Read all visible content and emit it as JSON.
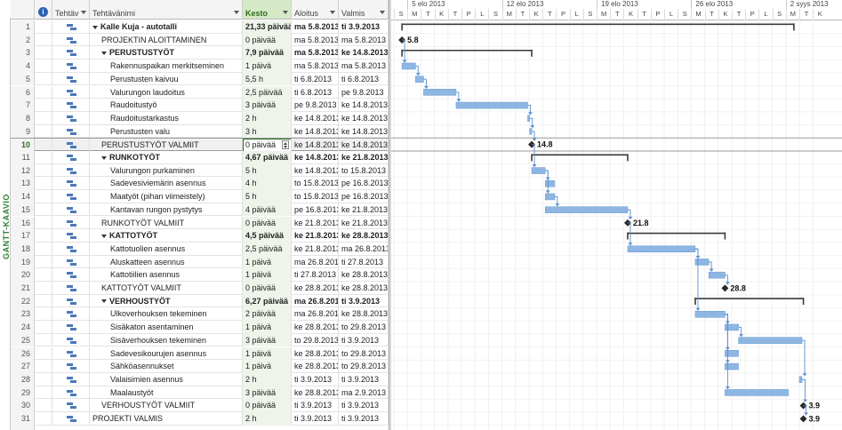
{
  "side_label": "GANTT-KAAVIO",
  "columns": {
    "info": "i",
    "mode": "Tehtäv",
    "name": "Tehtävänimi",
    "duration": "Kesto",
    "start": "Aloitus",
    "finish": "Valmis"
  },
  "timescale": {
    "weeks": [
      "5 elo 2013",
      "12 elo 2013",
      "19 elo 2013",
      "26 elo 2013",
      "2 syys 2013"
    ],
    "days": [
      "S",
      "M",
      "T",
      "K",
      "T",
      "P",
      "L",
      "S",
      "M",
      "T",
      "K",
      "T",
      "P",
      "L",
      "S",
      "M",
      "T",
      "K",
      "T",
      "P",
      "L",
      "S",
      "M",
      "T",
      "K",
      "T",
      "P",
      "L",
      "S",
      "M",
      "T",
      "K"
    ]
  },
  "selected_row": 10,
  "tasks": [
    {
      "id": "1",
      "name": "Kalle Kuja - autotalli",
      "duration": "21,33 päivää",
      "start": "ma 5.8.2013",
      "finish": "ti 3.9.2013",
      "level": 0,
      "summary": true,
      "bold": true
    },
    {
      "id": "2",
      "name": "PROJEKTIN ALOITTAMINEN",
      "duration": "0 päivää",
      "start": "ma 5.8.2013",
      "finish": "ma 5.8.2013",
      "level": 1,
      "milestone": true,
      "mlabel": "5.8"
    },
    {
      "id": "3",
      "name": "PERUSTUSTYÖT",
      "duration": "7,9 päivää",
      "start": "ma 5.8.2013",
      "finish": "ke 14.8.2013",
      "level": 1,
      "summary": true,
      "bold": true
    },
    {
      "id": "4",
      "name": "Rakennuspaikan merkitseminen",
      "duration": "1 päivä",
      "start": "ma 5.8.2013",
      "finish": "ma 5.8.2013",
      "level": 2
    },
    {
      "id": "5",
      "name": "Perustusten kaivuu",
      "duration": "5,5 h",
      "start": "ti 6.8.2013",
      "finish": "ti 6.8.2013",
      "level": 2
    },
    {
      "id": "6",
      "name": "Valurungon laudoitus",
      "duration": "2,5 päivää",
      "start": "ti 6.8.2013",
      "finish": "pe 9.8.2013",
      "level": 2
    },
    {
      "id": "7",
      "name": "Raudoitustyö",
      "duration": "3 päivää",
      "start": "pe 9.8.2013",
      "finish": "ke 14.8.2013",
      "level": 2
    },
    {
      "id": "8",
      "name": "Raudoitustarkastus",
      "duration": "2 h",
      "start": "ke 14.8.2013",
      "finish": "ke 14.8.2013",
      "level": 2
    },
    {
      "id": "9",
      "name": "Perustusten valu",
      "duration": "3 h",
      "start": "ke 14.8.2013",
      "finish": "ke 14.8.2013",
      "level": 2
    },
    {
      "id": "10",
      "name": "PERUSTUSTYÖT VALMIIT",
      "duration": "0 päivää",
      "start": "ke 14.8.2013",
      "finish": "ke 14.8.2013",
      "level": 1,
      "milestone": true,
      "mlabel": "14.8"
    },
    {
      "id": "11",
      "name": "RUNKOTYÖT",
      "duration": "4,67 päivää",
      "start": "ke 14.8.2013",
      "finish": "ke 21.8.2013",
      "level": 1,
      "summary": true,
      "bold": true
    },
    {
      "id": "12",
      "name": "Valurungon purkaminen",
      "duration": "5 h",
      "start": "ke 14.8.2013",
      "finish": "to 15.8.2013",
      "level": 2
    },
    {
      "id": "13",
      "name": "Sadevesiviemärin asennus",
      "duration": "4 h",
      "start": "to 15.8.2013",
      "finish": "pe 16.8.2013",
      "level": 2
    },
    {
      "id": "14",
      "name": "Maatyöt (pihan viimeistely)",
      "duration": "5 h",
      "start": "to 15.8.2013",
      "finish": "pe 16.8.2013",
      "level": 2
    },
    {
      "id": "15",
      "name": "Kantavan rungon pystytys",
      "duration": "4 päivää",
      "start": "pe 16.8.2013",
      "finish": "ke 21.8.2013",
      "level": 2
    },
    {
      "id": "16",
      "name": "RUNKOTYÖT VALMIIT",
      "duration": "0 päivää",
      "start": "ke 21.8.2013",
      "finish": "ke 21.8.2013",
      "level": 1,
      "milestone": true,
      "mlabel": "21.8"
    },
    {
      "id": "17",
      "name": "KATTOTYÖT",
      "duration": "4,5 päivää",
      "start": "ke 21.8.2013",
      "finish": "ke 28.8.2013",
      "level": 1,
      "summary": true,
      "bold": true
    },
    {
      "id": "18",
      "name": "Kattotuolien asennus",
      "duration": "2,5 päivää",
      "start": "ke 21.8.2013",
      "finish": "ma 26.8.2013",
      "level": 2
    },
    {
      "id": "19",
      "name": "Aluskatteen asennus",
      "duration": "1 päivä",
      "start": "ma 26.8.2013",
      "finish": "ti 27.8.2013",
      "level": 2
    },
    {
      "id": "20",
      "name": "Kattotiilien asennus",
      "duration": "1 päivä",
      "start": "ti 27.8.2013",
      "finish": "ke 28.8.2013",
      "level": 2
    },
    {
      "id": "21",
      "name": "KATTOTYÖT VALMIIT",
      "duration": "0 päivää",
      "start": "ke 28.8.2013",
      "finish": "ke 28.8.2013",
      "level": 1,
      "milestone": true,
      "mlabel": "28.8"
    },
    {
      "id": "22",
      "name": "VERHOUSTYÖT",
      "duration": "6,27 päivää",
      "start": "ma 26.8.2013",
      "finish": "ti 3.9.2013",
      "level": 1,
      "summary": true,
      "bold": true
    },
    {
      "id": "23",
      "name": "Ulkoverhouksen tekeminen",
      "duration": "2 päivää",
      "start": "ma 26.8.2013",
      "finish": "ke 28.8.2013",
      "level": 2
    },
    {
      "id": "24",
      "name": "Sisäkaton asentaminen",
      "duration": "1 päivä",
      "start": "ke 28.8.2013",
      "finish": "to 29.8.2013",
      "level": 2
    },
    {
      "id": "25",
      "name": "Sisäverhouksen tekeminen",
      "duration": "3 päivää",
      "start": "to 29.8.2013",
      "finish": "ti 3.9.2013",
      "level": 2
    },
    {
      "id": "26",
      "name": "Sadevesikourujen asennus",
      "duration": "1 päivä",
      "start": "ke 28.8.2013",
      "finish": "to 29.8.2013",
      "level": 2
    },
    {
      "id": "27",
      "name": "Sähköasennukset",
      "duration": "1 päivä",
      "start": "ke 28.8.2013",
      "finish": "to 29.8.2013",
      "level": 2
    },
    {
      "id": "28",
      "name": "Valaisimien asennus",
      "duration": "2 h",
      "start": "ti 3.9.2013",
      "finish": "ti 3.9.2013",
      "level": 2
    },
    {
      "id": "29",
      "name": "Maalaustyöt",
      "duration": "3 päivää",
      "start": "ke 28.8.2013",
      "finish": "ma 2.9.2013",
      "level": 2
    },
    {
      "id": "30",
      "name": "VERHOUSTYÖT VALMIIT",
      "duration": "0 päivää",
      "start": "ti 3.9.2013",
      "finish": "ti 3.9.2013",
      "level": 1,
      "milestone": true,
      "mlabel": "3.9"
    },
    {
      "id": "31",
      "name": "PROJEKTI VALMIS",
      "duration": "2 h",
      "start": "ti 3.9.2013",
      "finish": "ti 3.9.2013",
      "level": 0,
      "milestone": true,
      "mlabel": "3.9"
    }
  ],
  "bars": [
    {
      "row": 1,
      "type": "summary",
      "s": 0.6,
      "e": 29.6
    },
    {
      "row": 2,
      "type": "milestone",
      "s": 0.6
    },
    {
      "row": 3,
      "type": "summary",
      "s": 0.6,
      "e": 10.2
    },
    {
      "row": 4,
      "type": "task",
      "s": 0.6,
      "e": 1.6
    },
    {
      "row": 5,
      "type": "task",
      "s": 1.6,
      "e": 2.2
    },
    {
      "row": 6,
      "type": "task",
      "s": 2.2,
      "e": 4.6
    },
    {
      "row": 7,
      "type": "task",
      "s": 4.6,
      "e": 9.9
    },
    {
      "row": 8,
      "type": "task",
      "s": 9.9,
      "e": 10.05
    },
    {
      "row": 9,
      "type": "task",
      "s": 10.05,
      "e": 10.2
    },
    {
      "row": 10,
      "type": "milestone",
      "s": 10.2
    },
    {
      "row": 11,
      "type": "summary",
      "s": 10.2,
      "e": 17.3
    },
    {
      "row": 12,
      "type": "task",
      "s": 10.2,
      "e": 11.2
    },
    {
      "row": 13,
      "type": "task",
      "s": 11.2,
      "e": 11.9
    },
    {
      "row": 14,
      "type": "task",
      "s": 11.2,
      "e": 11.9
    },
    {
      "row": 15,
      "type": "task",
      "s": 11.2,
      "e": 17.3
    },
    {
      "row": 16,
      "type": "milestone",
      "s": 17.3
    },
    {
      "row": 17,
      "type": "summary",
      "s": 17.3,
      "e": 24.5
    },
    {
      "row": 18,
      "type": "task",
      "s": 17.3,
      "e": 22.3
    },
    {
      "row": 19,
      "type": "task",
      "s": 22.3,
      "e": 23.3
    },
    {
      "row": 20,
      "type": "task",
      "s": 23.3,
      "e": 24.5
    },
    {
      "row": 21,
      "type": "milestone",
      "s": 24.5
    },
    {
      "row": 22,
      "type": "summary",
      "s": 22.3,
      "e": 30.3
    },
    {
      "row": 23,
      "type": "task",
      "s": 22.3,
      "e": 24.5
    },
    {
      "row": 24,
      "type": "task",
      "s": 24.5,
      "e": 25.5
    },
    {
      "row": 25,
      "type": "task",
      "s": 25.5,
      "e": 30.2
    },
    {
      "row": 26,
      "type": "task",
      "s": 24.5,
      "e": 25.5
    },
    {
      "row": 27,
      "type": "task",
      "s": 24.5,
      "e": 25.5
    },
    {
      "row": 28,
      "type": "task",
      "s": 30.0,
      "e": 30.2
    },
    {
      "row": 29,
      "type": "task",
      "s": 24.5,
      "e": 29.2
    },
    {
      "row": 30,
      "type": "milestone",
      "s": 30.3
    },
    {
      "row": 31,
      "type": "milestone",
      "s": 30.3
    }
  ],
  "links": [
    [
      2,
      4
    ],
    [
      4,
      5
    ],
    [
      5,
      6
    ],
    [
      6,
      7
    ],
    [
      7,
      8
    ],
    [
      8,
      9
    ],
    [
      9,
      10
    ],
    [
      10,
      12
    ],
    [
      12,
      13
    ],
    [
      12,
      14
    ],
    [
      14,
      15
    ],
    [
      15,
      16
    ],
    [
      16,
      18
    ],
    [
      18,
      19
    ],
    [
      19,
      20
    ],
    [
      20,
      21
    ],
    [
      18,
      23
    ],
    [
      23,
      24
    ],
    [
      24,
      25
    ],
    [
      23,
      26
    ],
    [
      23,
      27
    ],
    [
      23,
      29
    ],
    [
      25,
      28
    ],
    [
      28,
      30
    ],
    [
      30,
      31
    ]
  ],
  "colors": {
    "task_bar": "#8db6e3",
    "task_bar_edge": "#6a9bd1",
    "summary": "#3a3a3a",
    "link": "#5a8fcf",
    "milestone": "#2a2a2a",
    "sorted_header": "#d6e9c6",
    "side_label": "#2f7d32"
  }
}
